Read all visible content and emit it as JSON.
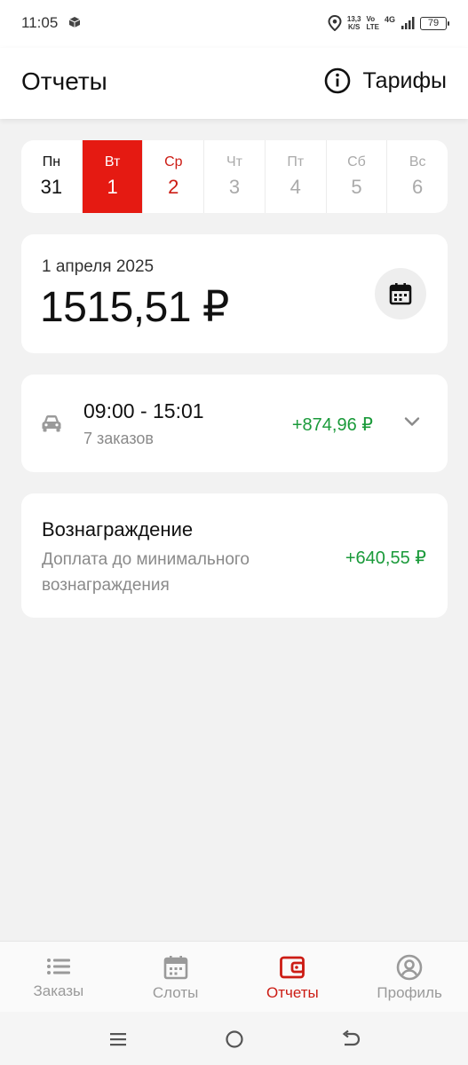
{
  "status_bar": {
    "time": "11:05",
    "speed_value": "13,3",
    "speed_unit": "K/S",
    "volte_top": "Vo",
    "volte_bottom": "LTE",
    "network": "4G",
    "battery": "79"
  },
  "header": {
    "title": "Отчеты",
    "tariffs_label": "Тарифы"
  },
  "week": [
    {
      "name": "Пн",
      "num": "31",
      "state": "past"
    },
    {
      "name": "Вт",
      "num": "1",
      "state": "selected"
    },
    {
      "name": "Ср",
      "num": "2",
      "state": "today"
    },
    {
      "name": "Чт",
      "num": "3",
      "state": "future"
    },
    {
      "name": "Пт",
      "num": "4",
      "state": "future"
    },
    {
      "name": "Сб",
      "num": "5",
      "state": "future"
    },
    {
      "name": "Вс",
      "num": "6",
      "state": "future"
    }
  ],
  "summary": {
    "date": "1 апреля 2025",
    "total": "1515,51 ₽"
  },
  "slot": {
    "time_range": "09:00 - 15:01",
    "orders": "7 заказов",
    "amount": "+874,96 ₽"
  },
  "reward": {
    "title": "Вознаграждение",
    "description": "Доплата до минимального вознаграждения",
    "amount": "+640,55 ₽"
  },
  "bottom_nav": [
    {
      "label": "Заказы",
      "icon": "list-icon",
      "active": false
    },
    {
      "label": "Слоты",
      "icon": "calendar-slots-icon",
      "active": false
    },
    {
      "label": "Отчеты",
      "icon": "wallet-icon",
      "active": true
    },
    {
      "label": "Профиль",
      "icon": "profile-icon",
      "active": false
    }
  ],
  "colors": {
    "accent": "#e51a12",
    "positive": "#1a9a3a",
    "background": "#f2f2f2"
  }
}
